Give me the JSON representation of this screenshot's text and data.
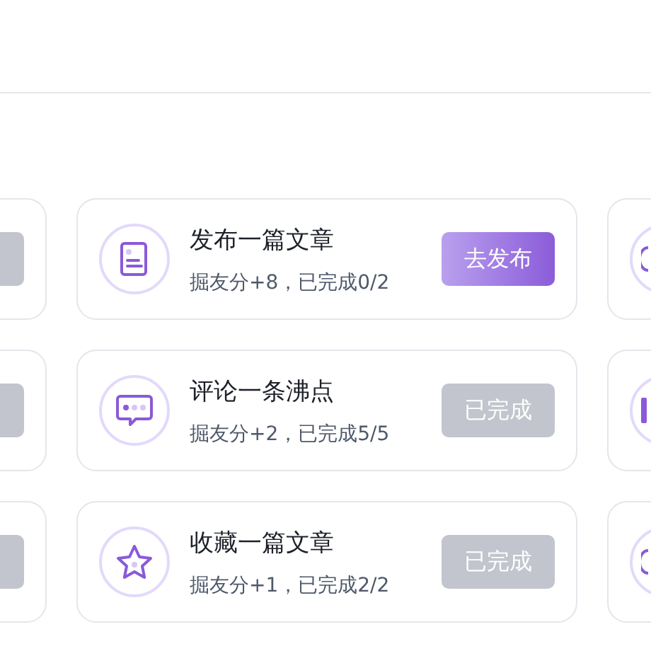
{
  "tasks": [
    {
      "kind": "article",
      "title": "发布一篇文章",
      "reward": "掘友分+8，已完成0/2",
      "button": {
        "label": "去发布",
        "done": false
      }
    },
    {
      "kind": "comment",
      "title": "评论一条沸点",
      "reward": "掘友分+2，已完成5/5",
      "button": {
        "label": "已完成",
        "done": true
      }
    },
    {
      "kind": "collect",
      "title": "收藏一篇文章",
      "reward": "掘友分+1，已完成2/2",
      "button": {
        "label": "已完成",
        "done": true
      }
    }
  ],
  "left_column": [
    {
      "button_done": true
    },
    {
      "button_done": true
    },
    {
      "button_done": true
    }
  ],
  "right_column": [
    {
      "kind": "round"
    },
    {
      "kind": "bar"
    },
    {
      "kind": "round"
    }
  ]
}
